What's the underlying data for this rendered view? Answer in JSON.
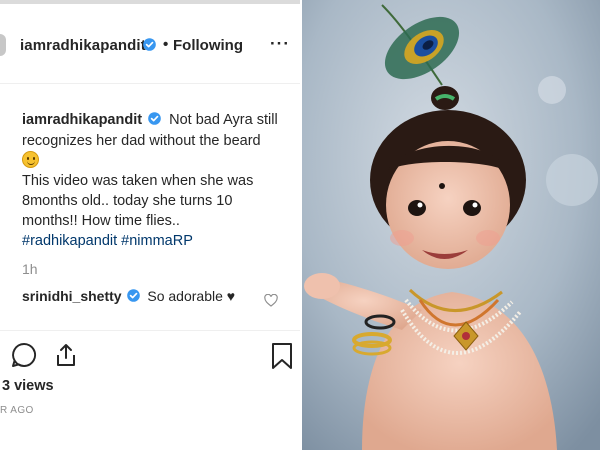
{
  "post": {
    "username": "iamradhikapandit",
    "separator": "•",
    "follow_status": "Following",
    "more_label": "···",
    "caption": {
      "username": "iamradhikapandit",
      "text_1": "Not bad Ayra still recognizes her dad without the beard",
      "text_2": "This video was taken when she was 8months old.. today she turns 10 months!! How time flies..",
      "hashtags": [
        "#radhikapandit",
        "#nimmaRP"
      ]
    },
    "time_ago": "1h",
    "comment": {
      "username": "srinidhi_shetty",
      "text": "So adorable ♥"
    },
    "views": "3 views",
    "posted": "R AGO"
  },
  "colors": {
    "text": "#262626",
    "muted": "#8e8e8e",
    "verified": "#3897f0",
    "hashtag": "#00376b",
    "photo_bg": "#a9b8c6"
  },
  "icons": [
    "verified-badge-icon",
    "more-options-icon",
    "smile-emoji-icon",
    "heart-icon",
    "comment-icon",
    "share-icon",
    "bookmark-icon"
  ]
}
